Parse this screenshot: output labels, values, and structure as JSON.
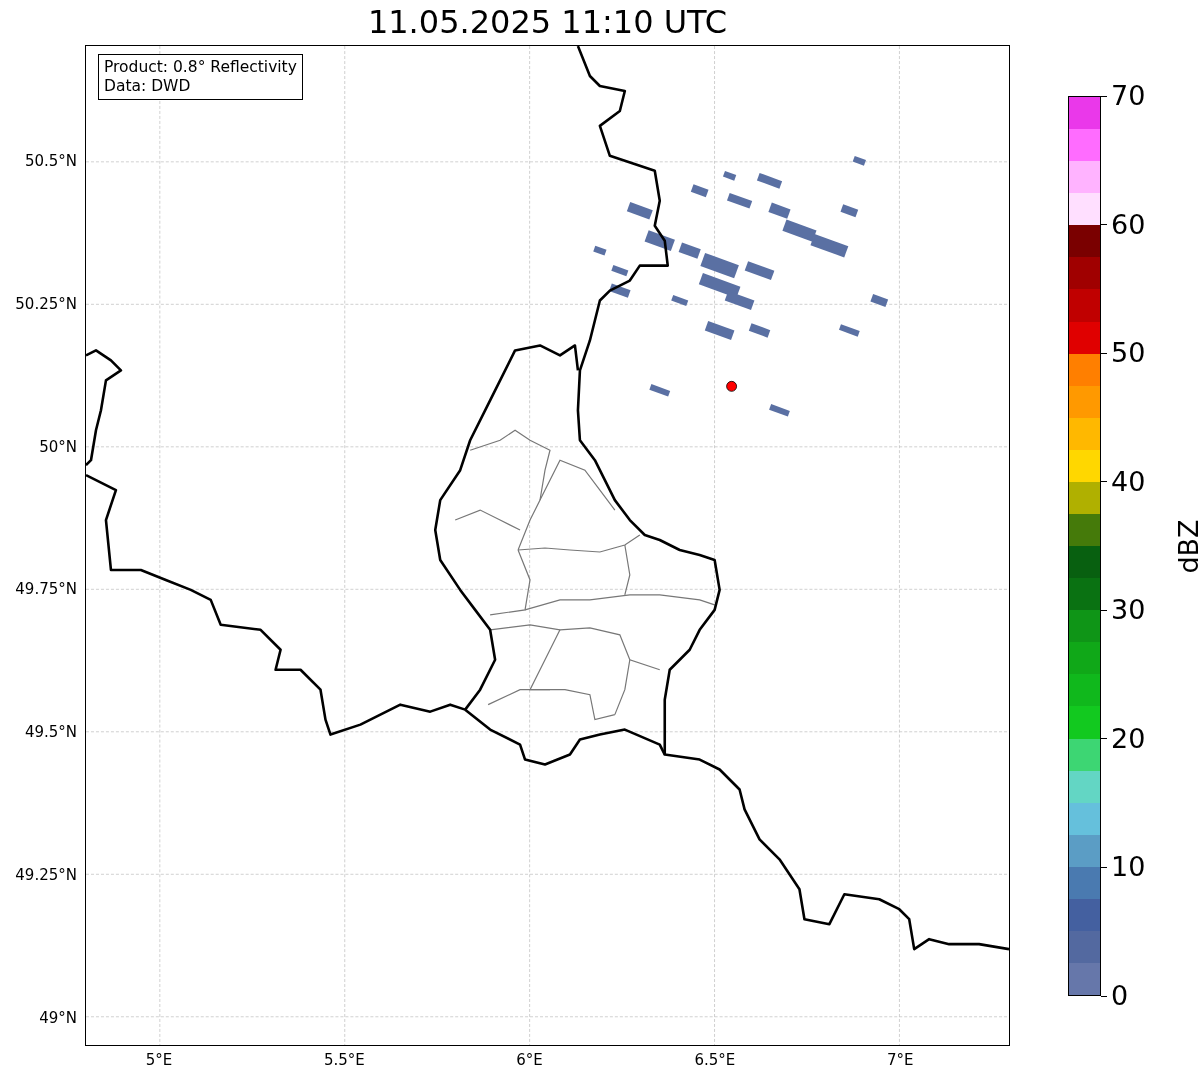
{
  "title": "11.05.2025 11:10 UTC",
  "info_box": {
    "lines": [
      "Product: 0.8° Reflectivity",
      "Data: DWD"
    ]
  },
  "y_axis": {
    "ticks": [
      "50.5°N",
      "50.25°N",
      "50°N",
      "49.75°N",
      "49.5°N",
      "49.25°N",
      "49°N"
    ]
  },
  "x_axis": {
    "ticks": [
      "5°E",
      "5.5°E",
      "6°E",
      "6.5°E",
      "7°E"
    ]
  },
  "colorbar": {
    "label": "dBZ",
    "ticks": [
      "70",
      "60",
      "50",
      "40",
      "30",
      "20",
      "10",
      "0"
    ],
    "segments": [
      {
        "color": "#ea38ea"
      },
      {
        "color": "#ff6cff"
      },
      {
        "color": "#ffb3ff"
      },
      {
        "color": "#ffdfff"
      },
      {
        "color": "#7a0000"
      },
      {
        "color": "#a00000"
      },
      {
        "color": "#c00000"
      },
      {
        "color": "#e00000"
      },
      {
        "color": "#ff7f00"
      },
      {
        "color": "#ff9900"
      },
      {
        "color": "#ffb800"
      },
      {
        "color": "#ffd700"
      },
      {
        "color": "#b0b000"
      },
      {
        "color": "#457a0a"
      },
      {
        "color": "#086010"
      },
      {
        "color": "#0a7212"
      },
      {
        "color": "#0f9517"
      },
      {
        "color": "#10a818"
      },
      {
        "color": "#10b81c"
      },
      {
        "color": "#12c91f"
      },
      {
        "color": "#3dd673"
      },
      {
        "color": "#63d6c4"
      },
      {
        "color": "#65c0dc"
      },
      {
        "color": "#5b9dc5"
      },
      {
        "color": "#4a7ab0"
      },
      {
        "color": "#4460a0"
      },
      {
        "color": "#5369a0"
      },
      {
        "color": "#6677aa"
      }
    ]
  }
}
